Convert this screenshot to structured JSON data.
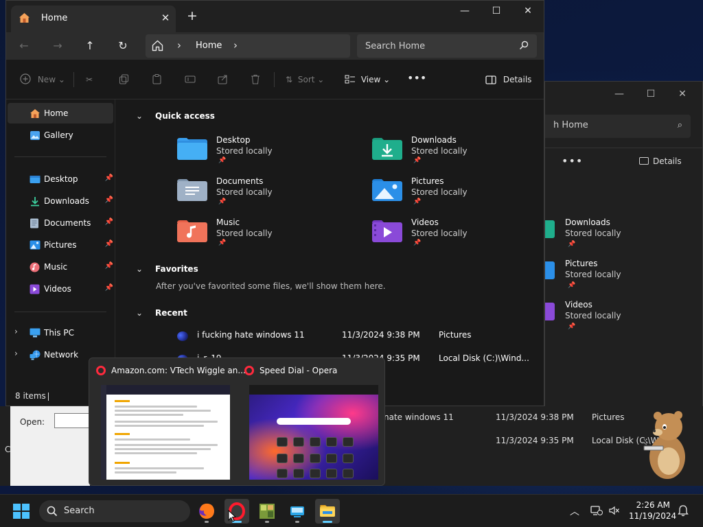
{
  "main_window": {
    "tab_title": "Home",
    "address": {
      "crumb": "Home"
    },
    "search": {
      "placeholder": "Search Home"
    },
    "commands": {
      "new": "New",
      "sort": "Sort",
      "view": "View",
      "more": "•••",
      "details": "Details"
    },
    "sidebar": {
      "top_items": [
        {
          "label": "Home",
          "icon": "home-icon"
        },
        {
          "label": "Gallery",
          "icon": "gallery-icon"
        }
      ],
      "pinned_items": [
        {
          "label": "Desktop",
          "icon": "desktop-folder-icon"
        },
        {
          "label": "Downloads",
          "icon": "downloads-icon"
        },
        {
          "label": "Documents",
          "icon": "documents-icon"
        },
        {
          "label": "Pictures",
          "icon": "pictures-icon"
        },
        {
          "label": "Music",
          "icon": "music-icon"
        },
        {
          "label": "Videos",
          "icon": "videos-icon"
        }
      ],
      "tree_items": [
        {
          "label": "This PC",
          "icon": "pc-icon"
        },
        {
          "label": "Network",
          "icon": "network-icon"
        }
      ]
    },
    "quick_access": {
      "heading": "Quick access",
      "items": [
        {
          "name": "Desktop",
          "sub": "Stored locally",
          "color": "#2f8fe0"
        },
        {
          "name": "Downloads",
          "sub": "Stored locally",
          "color": "#1fae8c"
        },
        {
          "name": "Documents",
          "sub": "Stored locally",
          "color": "#9fb1c6"
        },
        {
          "name": "Pictures",
          "sub": "Stored locally",
          "color": "#2b8fe8"
        },
        {
          "name": "Music",
          "sub": "Stored locally",
          "color": "#f0735a"
        },
        {
          "name": "Videos",
          "sub": "Stored locally",
          "color": "#8a4ad8"
        }
      ]
    },
    "favorites": {
      "heading": "Favorites",
      "note": "After you've favorited some files, we'll show them here."
    },
    "recent": {
      "heading": "Recent",
      "rows": [
        {
          "name": "i fucking hate windows 11",
          "date": "11/3/2024 9:38 PM",
          "location": "Pictures"
        },
        {
          "name": "i_r_19",
          "date": "11/3/2024 9:35 PM",
          "location": "Local Disk (C:)\\Wind..."
        }
      ]
    },
    "status": {
      "count": "8 items"
    }
  },
  "background_window": {
    "search_text": "h Home",
    "details": "Details",
    "more": "•••",
    "items": [
      {
        "name": "Downloads",
        "sub": "Stored locally",
        "color": "#1fae8c"
      },
      {
        "name": "Pictures",
        "sub": "Stored locally",
        "color": "#2b8fe8"
      },
      {
        "name": "Videos",
        "sub": "Stored locally",
        "color": "#8a4ad8"
      }
    ],
    "recent_rows": [
      {
        "name": "nate windows 11",
        "date": "11/3/2024 9:38 PM",
        "location": "Pictures"
      },
      {
        "name": "",
        "date": "11/3/2024 9:35 PM",
        "location": "Local Disk (C:\\Wi"
      }
    ]
  },
  "run_dialog": {
    "open_label": "Open:",
    "edge_char": "C"
  },
  "thumbnails": [
    {
      "title": "Amazon.com: VTech Wiggle an..."
    },
    {
      "title": "Speed Dial - Opera"
    }
  ],
  "taskbar": {
    "search_label": "Search",
    "apps": [
      {
        "name": "firefox",
        "icon": "firefox-icon"
      },
      {
        "name": "opera",
        "icon": "opera-icon"
      },
      {
        "name": "game",
        "icon": "game-icon"
      },
      {
        "name": "app",
        "icon": "app-icon"
      },
      {
        "name": "file-explorer",
        "icon": "file-explorer-icon"
      }
    ],
    "time": "2:26 AM",
    "date": "11/19/2024"
  },
  "colors": {
    "accent": "#60cdff",
    "opera": "#ff1b2d",
    "folder": "#f5c542"
  }
}
